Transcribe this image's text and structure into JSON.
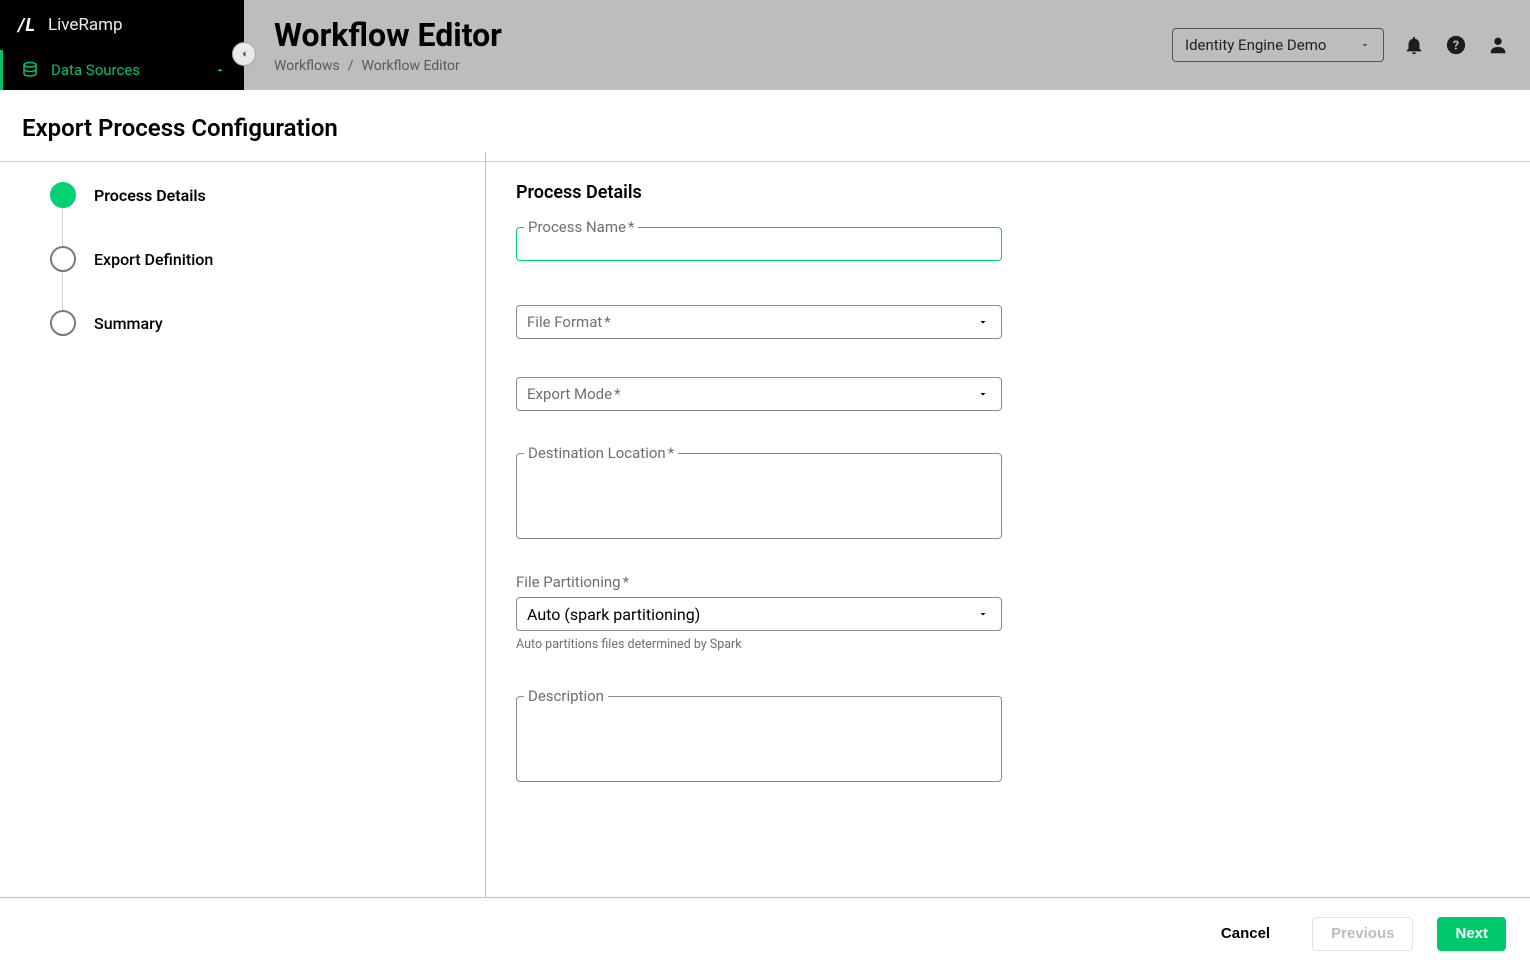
{
  "brand": {
    "logo": "/L",
    "name": "LiveRamp"
  },
  "sidebar": {
    "items": [
      {
        "label": "Data Sources"
      }
    ]
  },
  "header": {
    "title": "Workflow Editor",
    "breadcrumb": {
      "parent": "Workflows",
      "sep": "/",
      "current": "Workflow Editor"
    },
    "tenant": "Identity Engine Demo"
  },
  "panel": {
    "title": "Export Process Configuration",
    "steps": [
      {
        "label": "Process Details",
        "active": true
      },
      {
        "label": "Export Definition",
        "active": false
      },
      {
        "label": "Summary",
        "active": false
      }
    ],
    "form": {
      "title": "Process Details",
      "process_name": {
        "label": "Process Name",
        "value": ""
      },
      "file_format": {
        "label": "File Format",
        "value": ""
      },
      "export_mode": {
        "label": "Export Mode",
        "value": ""
      },
      "destination": {
        "label": "Destination Location",
        "value": ""
      },
      "partitioning": {
        "label": "File Partitioning",
        "value": "Auto (spark partitioning)",
        "helper": "Auto partitions files determined by Spark"
      },
      "description": {
        "label": "Description",
        "value": ""
      },
      "required_mark": "*"
    }
  },
  "footer": {
    "cancel": "Cancel",
    "previous": "Previous",
    "next": "Next"
  }
}
